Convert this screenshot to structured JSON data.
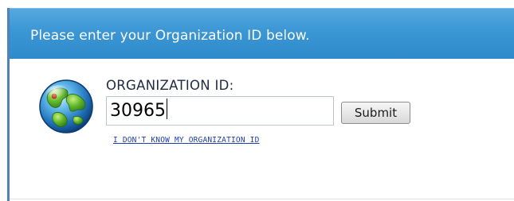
{
  "header": {
    "message": "Please enter your Organization ID below."
  },
  "form": {
    "label": "ORGANIZATION ID:",
    "org_id_value": "30965",
    "submit_label": "Submit",
    "help_link": "I DON'T KNOW MY ORGANIZATION ID"
  },
  "icons": {
    "globe": "globe-icon"
  },
  "colors": {
    "header_bar": "#3b96d4",
    "left_border": "#4f81bd",
    "link": "#1f3fa8"
  }
}
